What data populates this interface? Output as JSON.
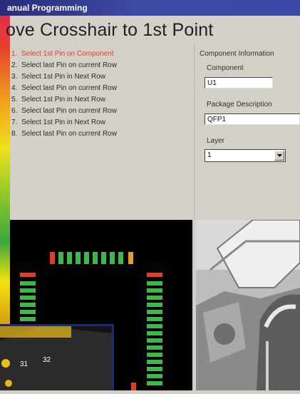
{
  "window": {
    "title": "anual Programming"
  },
  "heading": "ove Crosshair to 1st Point",
  "steps": [
    {
      "num": "1.",
      "label": "Select 1st Pin on Component"
    },
    {
      "num": "2.",
      "label": "Select last Pin on current Row"
    },
    {
      "num": "3.",
      "label": "Select 1st Pin in Next Row"
    },
    {
      "num": "4.",
      "label": "Select last Pin on current Row"
    },
    {
      "num": "5.",
      "label": "Select 1st Pin in Next Row"
    },
    {
      "num": "6.",
      "label": "Select last Pin on current Row"
    },
    {
      "num": "7.",
      "label": "Select 1st Pin in Next Row"
    },
    {
      "num": "8.",
      "label": "Select last Pin on current Row"
    }
  ],
  "component_info": {
    "section_label": "Component Information",
    "component_label": "Component",
    "component_value": "U1",
    "package_label": "Package Description",
    "package_value": "QFP1",
    "layer_label": "Layer",
    "layer_value": "1"
  },
  "photo_inset": {
    "numbers": [
      "31",
      "32"
    ]
  },
  "colors": {
    "active_step": "#e33b2e",
    "title_bar": "#3c4aa2",
    "pad_green": "#3fb84b",
    "pad_red": "#e03a2a"
  }
}
